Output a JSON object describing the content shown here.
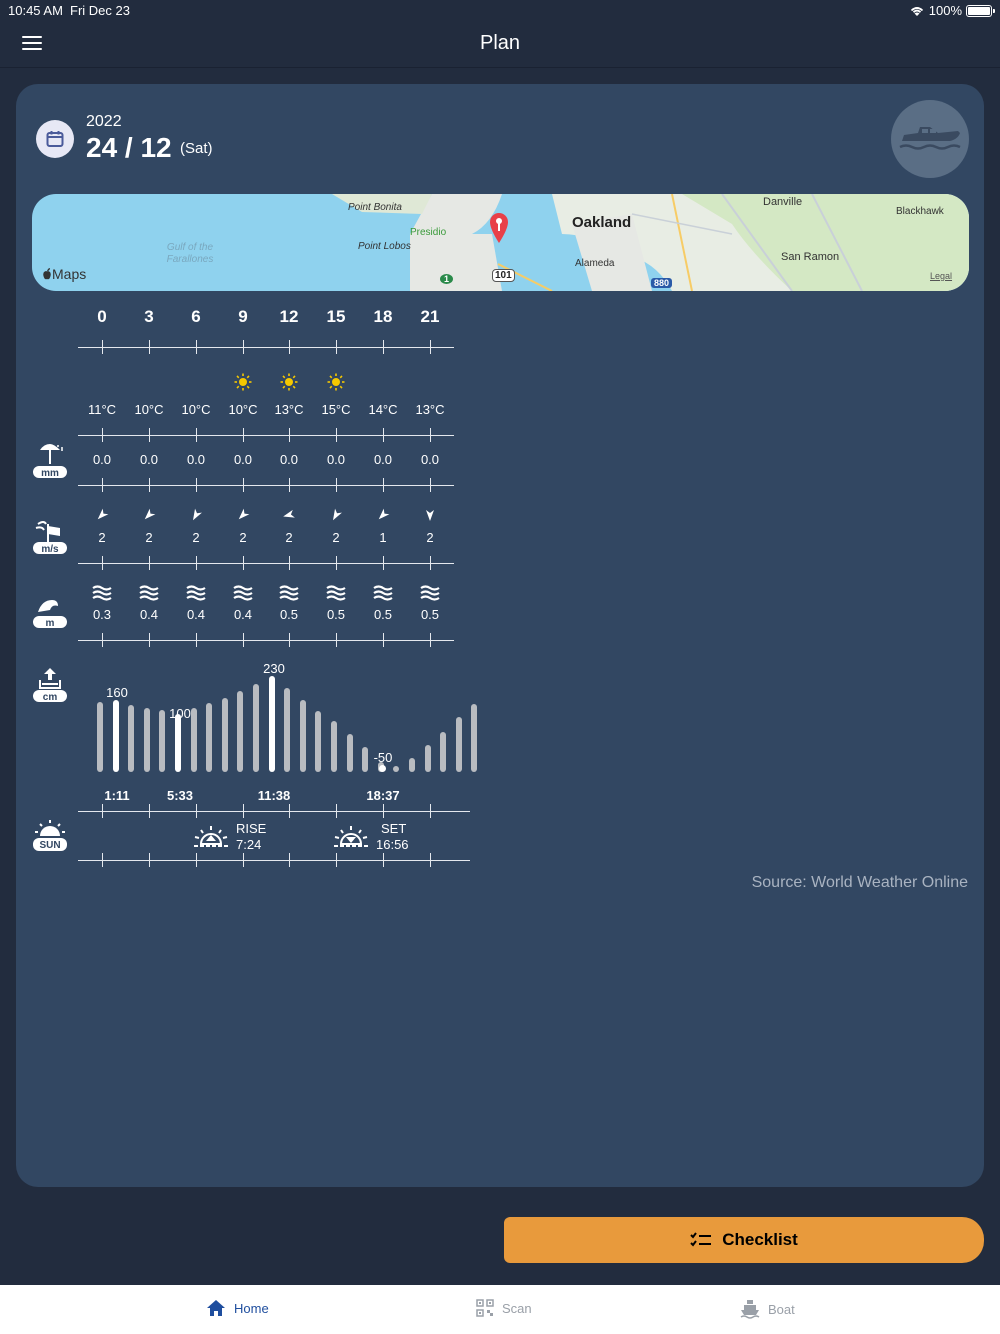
{
  "status": {
    "time": "10:45 AM",
    "date": "Fri Dec 23",
    "battery": "100%"
  },
  "nav": {
    "title": "Plan"
  },
  "date_block": {
    "year": "2022",
    "day_month": "24 / 12",
    "weekday": "(Sat)"
  },
  "map": {
    "brand": "Maps",
    "legal": "Legal",
    "labels": [
      "Point Bonita",
      "Presidio",
      "Point Lobos",
      "Oakland",
      "Alameda",
      "Danville",
      "Blackhawk",
      "San Ramon",
      "Gulf of the Farallones",
      "101",
      "880",
      "1"
    ]
  },
  "hours": [
    "0",
    "3",
    "6",
    "9",
    "12",
    "15",
    "18",
    "21"
  ],
  "weather": {
    "icons": [
      "moon-icon",
      "moon-icon",
      "moon-icon",
      "sun-icon",
      "sun-icon",
      "sun-icon",
      "moon-icon",
      "moon-icon"
    ],
    "temps": [
      "11°C",
      "10°C",
      "10°C",
      "10°C",
      "13°C",
      "15°C",
      "14°C",
      "13°C"
    ]
  },
  "precip": {
    "unit": "mm",
    "values": [
      "0.0",
      "0.0",
      "0.0",
      "0.0",
      "0.0",
      "0.0",
      "0.0",
      "0.0"
    ]
  },
  "wind": {
    "unit": "m/s",
    "values": [
      "2",
      "2",
      "2",
      "2",
      "2",
      "2",
      "1",
      "2"
    ],
    "directions_deg": [
      45,
      45,
      30,
      45,
      75,
      30,
      45,
      0
    ]
  },
  "waves": {
    "unit": "m",
    "values": [
      "0.3",
      "0.4",
      "0.4",
      "0.4",
      "0.5",
      "0.5",
      "0.5",
      "0.5"
    ]
  },
  "tide": {
    "unit": "cm",
    "peak_labels": [
      {
        "value": "160",
        "time": "1:11"
      },
      {
        "value": "100",
        "time": "5:33"
      },
      {
        "value": "230",
        "time": "11:38"
      },
      {
        "value": "-50",
        "time": "18:37"
      }
    ]
  },
  "sun": {
    "label": "SUN",
    "rise_label": "RISE",
    "rise_time": "7:24",
    "set_label": "SET",
    "set_time": "16:56"
  },
  "source": "Source: World Weather Online",
  "checklist_label": "Checklist",
  "tabs": {
    "home": "Home",
    "scan": "Scan",
    "boat": "Boat"
  },
  "colors": {
    "background": "#222c3e",
    "card": "#324762",
    "accent": "#e89a3c",
    "tab_active": "#1f4e9e"
  }
}
